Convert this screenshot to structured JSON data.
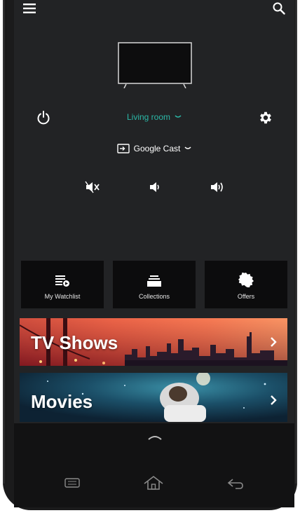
{
  "header": {
    "menu_icon": "hamburger-menu-icon",
    "search_icon": "search-icon"
  },
  "device": {
    "room_name": "Living room",
    "cast_label": "Google Cast",
    "accent_color": "#2bb8a7"
  },
  "controls": {
    "power_icon": "power-icon",
    "settings_icon": "gear-icon",
    "mute_icon": "volume-mute-icon",
    "vol_down_icon": "volume-down-icon",
    "vol_up_icon": "volume-up-icon"
  },
  "tiles": [
    {
      "label": "My Watchlist",
      "icon": "watchlist-icon"
    },
    {
      "label": "Collections",
      "icon": "collections-icon"
    },
    {
      "label": "Offers",
      "icon": "offers-badge-icon"
    }
  ],
  "banners": [
    {
      "title": "TV Shows"
    },
    {
      "title": "Movies"
    }
  ],
  "nav": {
    "recent_icon": "recent-apps-icon",
    "home_icon": "home-icon",
    "back_icon": "back-icon",
    "expand_icon": "chevron-up-icon"
  }
}
